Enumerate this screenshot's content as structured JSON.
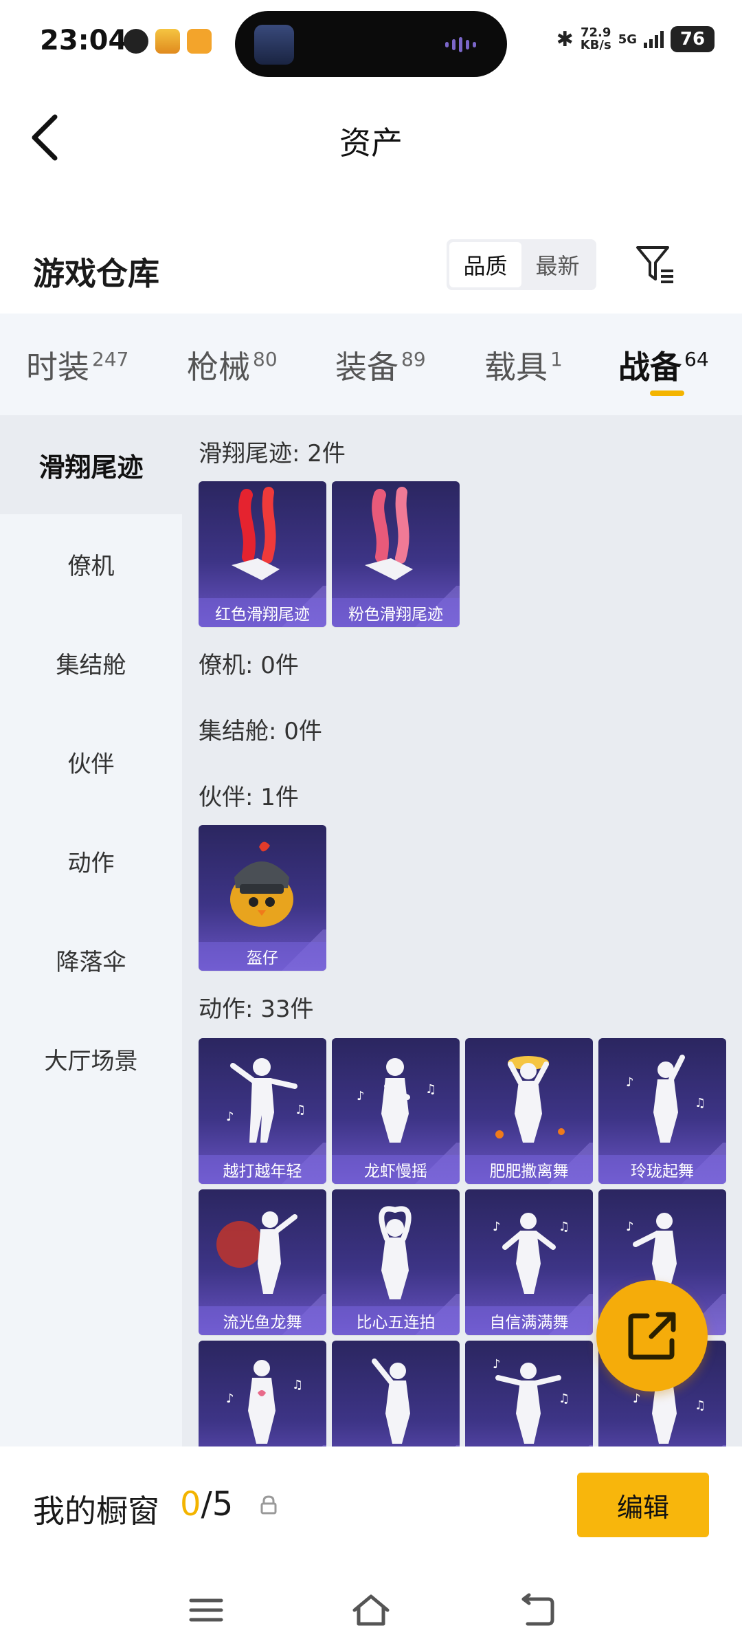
{
  "status_bar": {
    "time": "23:04",
    "speed_top": "72.9",
    "speed_unit": "KB/s",
    "network": "5G",
    "battery": "76"
  },
  "header": {
    "title": "资产"
  },
  "warehouse": {
    "title": "游戏仓库",
    "sort_options": [
      "品质",
      "最新"
    ],
    "active_sort": "品质"
  },
  "tabs": [
    {
      "label": "时装",
      "count": "247"
    },
    {
      "label": "枪械",
      "count": "80"
    },
    {
      "label": "装备",
      "count": "89"
    },
    {
      "label": "载具",
      "count": "1"
    },
    {
      "label": "战备",
      "count": "64"
    }
  ],
  "active_tab": "战备",
  "sidebar": {
    "items": [
      "滑翔尾迹",
      "僚机",
      "集结舱",
      "伙伴",
      "动作",
      "降落伞",
      "大厅场景"
    ],
    "active": "滑翔尾迹"
  },
  "sections": {
    "glide": {
      "label": "滑翔尾迹: 2件",
      "items": [
        "红色滑翔尾迹",
        "粉色滑翔尾迹"
      ]
    },
    "wingman": {
      "label": "僚机: 0件"
    },
    "capsule": {
      "label": "集结舱: 0件"
    },
    "partner": {
      "label": "伙伴: 1件",
      "items": [
        "盔仔"
      ]
    },
    "emote": {
      "label": "动作: 33件",
      "items": [
        "越打越年轻",
        "龙虾慢摇",
        "肥肥撒离舞",
        "玲珑起舞",
        "流光鱼龙舞",
        "比心五连拍",
        "自信满满舞",
        "",
        "",
        "",
        "",
        ""
      ]
    }
  },
  "showcase": {
    "label": "我的橱窗",
    "current": "0",
    "total": "/5",
    "edit_label": "编辑"
  },
  "colors": {
    "accent": "#f3b400",
    "card_bg": "#3d3486",
    "fab": "#f5ac0a"
  }
}
